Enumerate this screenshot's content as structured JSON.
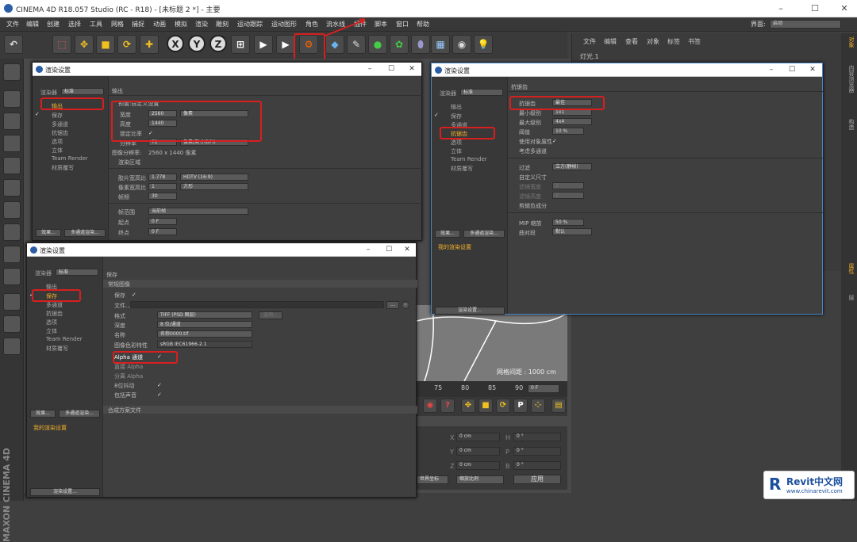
{
  "app": {
    "title": "CINEMA 4D R18.057 Studio (RC - R18) - [未标题 2 *] - 主要"
  },
  "menu": [
    "文件",
    "编辑",
    "创建",
    "选择",
    "工具",
    "网格",
    "捕捉",
    "动画",
    "模拟",
    "渲染",
    "雕刻",
    "运动跟踪",
    "运动图形",
    "角色",
    "流水线",
    "插件",
    "脚本",
    "窗口",
    "帮助"
  ],
  "layout": {
    "label": "界面:",
    "value": "启动"
  },
  "obj_menu": [
    "文件",
    "编辑",
    "查看",
    "对象",
    "标签",
    "书签"
  ],
  "obj_item": "灯光.1",
  "right_tabs": [
    "对象",
    "内容浏览器",
    "构造",
    "属性",
    "层"
  ],
  "vertical_brand": "MAXON CINEMA 4D",
  "viewport": {
    "grid_label": "网格间距 : 1000 cm"
  },
  "timeline": {
    "ticks": [
      "75",
      "80",
      "85",
      "90"
    ],
    "frame": "0 F"
  },
  "coords": {
    "rows": [
      [
        "X",
        "0 cm",
        "X",
        "0 cm",
        "H",
        "0 °"
      ],
      [
        "Y",
        "0 cm",
        "Y",
        "0 cm",
        "P",
        "0 °"
      ],
      [
        "Z",
        "0 cm",
        "Z",
        "0 cm",
        "B",
        "0 °"
      ]
    ],
    "world": "世界坐标",
    "scale": "缩放比例",
    "apply": "应用"
  },
  "watermark": {
    "brand": "Revit中文网",
    "url": "www.chinarevit.com"
  },
  "dialog": {
    "title": "渲染设置",
    "renderer_label": "渲染器",
    "renderer": "标准",
    "effects": "效果...",
    "multipass": "多通道渲染...",
    "my_settings": "我的渲染设置",
    "render_settings": "渲染设置...",
    "items": [
      "输出",
      "保存",
      "多通道",
      "抗锯齿",
      "选项",
      "立体",
      "Team Render",
      "材质覆写"
    ]
  },
  "dlg1": {
    "heading": "输出",
    "preset": "预置:自定义设置",
    "rows": [
      [
        "宽度",
        "2560",
        "像素"
      ],
      [
        "高度",
        "1440",
        ""
      ],
      [
        "锁定比率",
        "✓",
        ""
      ],
      [
        "分辨率",
        "72",
        "像素/英寸(DPI)"
      ],
      [
        "图像分辨率:",
        "2560 x 1440 像素",
        ""
      ],
      [
        "渲染区域",
        "",
        ""
      ],
      [
        "胶片宽高比",
        "1.778",
        "HDTV (16:9)"
      ],
      [
        "像素宽高比",
        "1",
        "方形"
      ],
      [
        "帧频",
        "30",
        ""
      ],
      [
        "帧范围",
        "当前帧",
        ""
      ],
      [
        "起点",
        "0 F",
        ""
      ],
      [
        "终点",
        "0 F",
        ""
      ]
    ]
  },
  "dlg2": {
    "heading": "保存",
    "section": "常规图像",
    "section2": "合成方案文件",
    "rows": [
      [
        "保存",
        "✓",
        ""
      ],
      [
        "文件...",
        "",
        ""
      ],
      [
        "格式",
        "TIFF (PSD 图层)",
        "选项..."
      ],
      [
        "深度",
        "8 位/通道",
        ""
      ],
      [
        "名称",
        "名称0000.tif",
        ""
      ],
      [
        "图像色彩特性",
        "sRGB IEC61966-2.1",
        ""
      ],
      [
        "Alpha 通道",
        "✓",
        ""
      ],
      [
        "直接 Alpha",
        "",
        ""
      ],
      [
        "分离 Alpha",
        "",
        ""
      ],
      [
        "8位抖动",
        "✓",
        ""
      ],
      [
        "包括声音",
        "✓",
        ""
      ]
    ]
  },
  "dlg3": {
    "heading": "抗锯齿",
    "rows": [
      [
        "抗锯齿",
        "最佳"
      ],
      [
        "最小级别",
        "1x1"
      ],
      [
        "最大级别",
        "4x4"
      ],
      [
        "阈值",
        "10 %"
      ],
      [
        "使用对象属性",
        "✓"
      ],
      [
        "考虑多通道",
        ""
      ],
      [
        "过滤",
        "立方(静帧)"
      ],
      [
        "自定义尺寸",
        ""
      ],
      [
        "滤镜宽度",
        "2"
      ],
      [
        "滤镜高度",
        "2"
      ],
      [
        "剪辑负成分",
        ""
      ],
      [
        "MIP 缩放",
        "50 %"
      ],
      [
        "曲对段",
        "默认"
      ]
    ]
  }
}
